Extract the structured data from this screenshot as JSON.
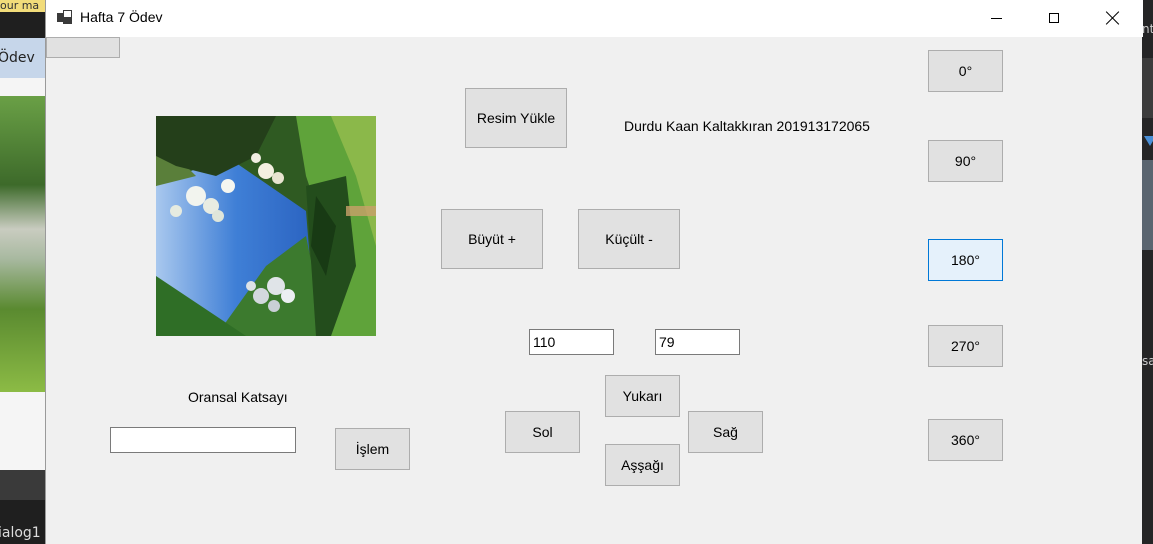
{
  "background": {
    "left_top_text": "our ma",
    "left_tab_text": "Ödev",
    "left_bottom_text": "ialog1",
    "right_text_1": "nt",
    "right_text_2": "sa"
  },
  "window": {
    "title": "Hafta 7 Ödev",
    "icon": "form-icon",
    "controls": [
      "minimize-icon",
      "maximize-icon",
      "close-icon"
    ]
  },
  "form": {
    "load_button": "Resim Yükle",
    "author_label": "Durdu Kaan Kaltakkıran 201913172065",
    "enlarge_button": "Büyüt +",
    "shrink_button": "Küçült -",
    "width_value": "110",
    "height_value": "79",
    "ratio_label": "Oransal Katsayı",
    "ratio_value": "",
    "process_button": "İşlem",
    "up_button": "Yukarı",
    "left_button": "Sol",
    "right_button": "Sağ",
    "down_button": "Aşşağı",
    "rotate_buttons": [
      "0°",
      "90°",
      "180°",
      "270°",
      "360°"
    ],
    "focused_rotate": "180°"
  },
  "colors": {
    "window_bg": "#f0f0f0",
    "button_bg": "#e1e1e1",
    "focus_border": "#0078d7"
  }
}
